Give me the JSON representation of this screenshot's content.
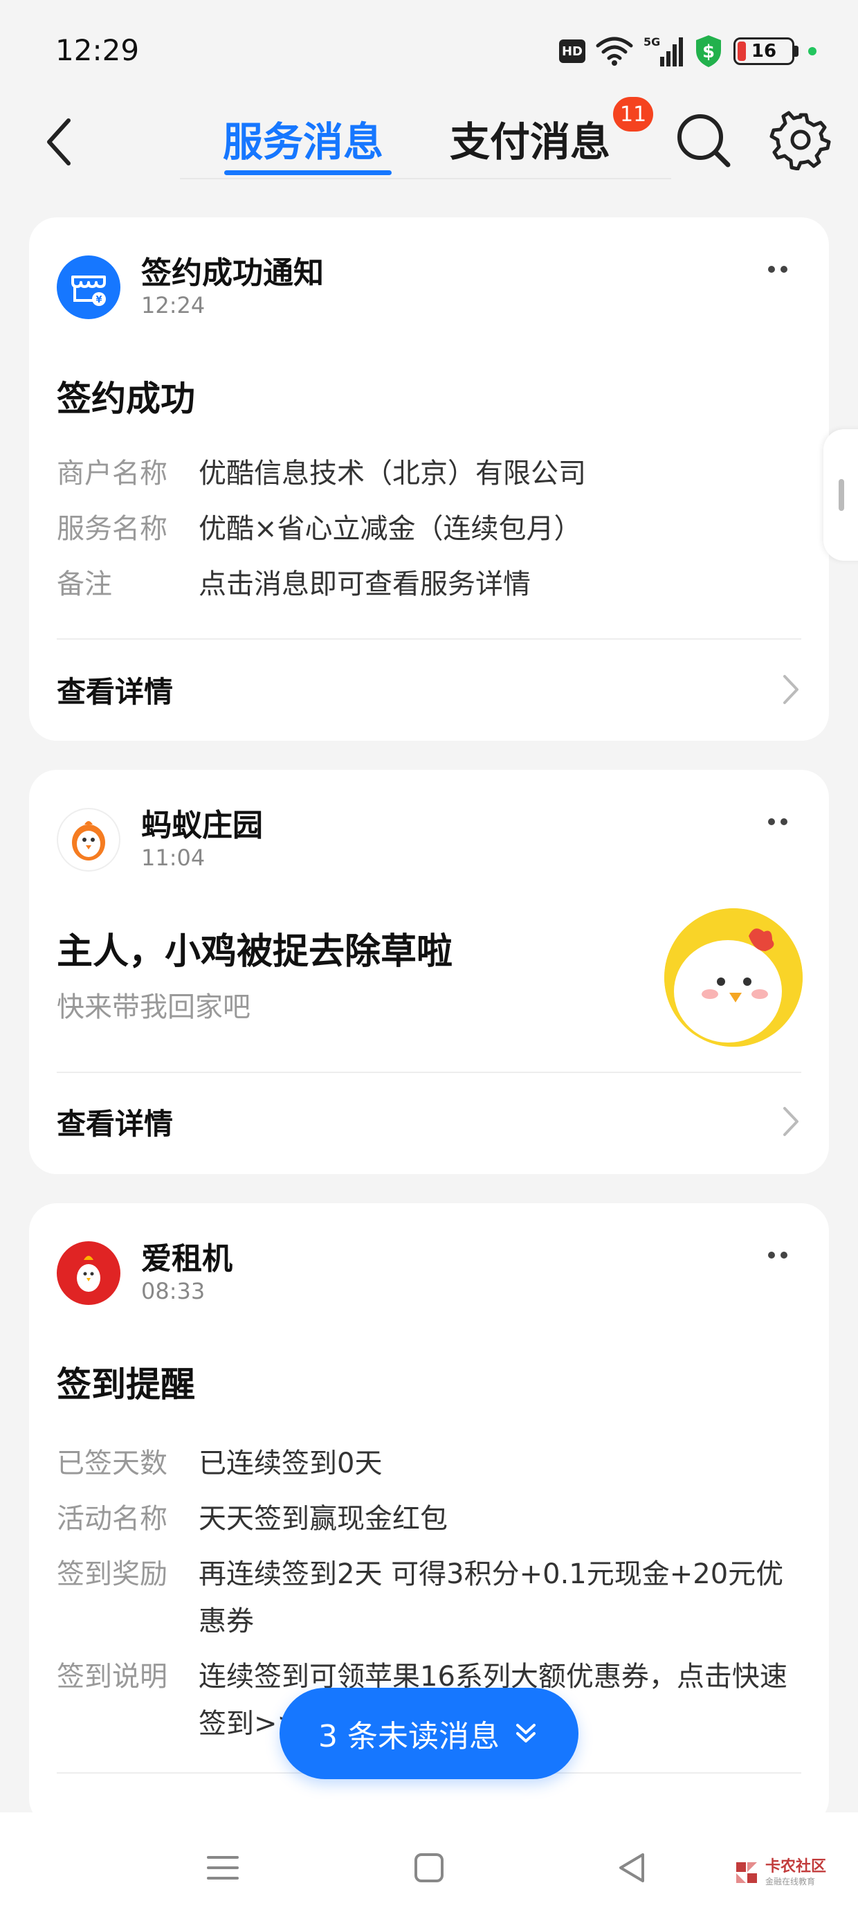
{
  "status_bar": {
    "time": "12:29",
    "hd": "HD",
    "network": "5G",
    "battery_level": "16",
    "battery_percent": 16
  },
  "nav": {
    "tabs": [
      {
        "label": "服务消息",
        "active": true
      },
      {
        "label": "支付消息",
        "active": false,
        "badge": "11"
      }
    ],
    "icons": [
      "back-icon",
      "search-icon",
      "gear-icon"
    ]
  },
  "cards": [
    {
      "app_name": "签约成功通知",
      "time": "12:24",
      "title": "签约成功",
      "fields": [
        {
          "key": "商户名称",
          "value": "优酷信息技术（北京）有限公司"
        },
        {
          "key": "服务名称",
          "value": "优酷×省心立减金（连续包月）"
        },
        {
          "key": "备注",
          "value": "点击消息即可查看服务详情"
        }
      ],
      "link": "查看详情"
    },
    {
      "app_name": "蚂蚁庄园",
      "time": "11:04",
      "title": "主人，小鸡被捉去除草啦",
      "subtitle": "快来带我回家吧",
      "link": "查看详情"
    },
    {
      "app_name": "爱租机",
      "time": "08:33",
      "title": "签到提醒",
      "fields": [
        {
          "key": "已签天数",
          "value": "已连续签到0天"
        },
        {
          "key": "活动名称",
          "value": "天天签到赢现金红包"
        },
        {
          "key": "签到奖励",
          "value": "再连续签到2天 可得3积分+0.1元现金+20元优惠券"
        },
        {
          "key": "签到说明",
          "value": "连续签到可领苹果16系列大额优惠券，点击快速签到>>"
        }
      ]
    }
  ],
  "unread_pill": "3 条未读消息",
  "watermark": {
    "title": "卡农社区",
    "subtitle": "金融在线教育"
  },
  "colors": {
    "accent": "#1677ff",
    "badge": "#f5431f",
    "background": "#f4f4f4"
  }
}
